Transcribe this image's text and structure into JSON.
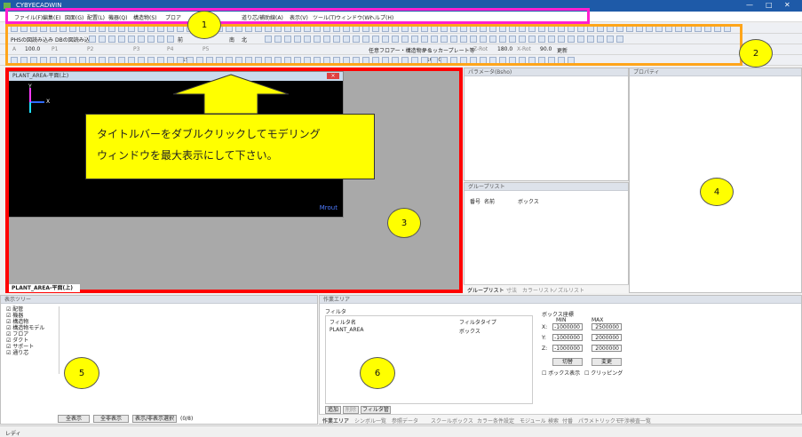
{
  "window": {
    "title": "CYBYECADWIN",
    "minimize": "—",
    "maximize": "□",
    "close": "✕"
  },
  "menu": [
    "ファイル(F)",
    "編集(E)",
    "図面(G)",
    "配置(L)",
    "機器(Q)",
    "構造物(S)",
    "プロア",
    "道り芯/補助線(A)",
    "表示(V)",
    "ツール(T)",
    "ウィンドウ(W)",
    "ヘルプ(H)"
  ],
  "toolbar": {
    "load_phs": "PHSの図読み込み",
    "load_db": "DBの図読み込み",
    "front": "前",
    "south": "南",
    "north": "北",
    "floor_label": "任意フロアー・構造物から",
    "checker_label": "チェッカープレート等",
    "zrot": "Z-Rot",
    "zrot_val": "180.0",
    "xrot": "X-Rot",
    "xrot_val": "90.0",
    "update": "更新",
    "row3_a": "100.0",
    "row3_b": "15.0",
    "row3_c": "100.0",
    "p1": "P1",
    "p2": "P2",
    "p3": "P3",
    "p4": "P4",
    "p5": "P5"
  },
  "model_window": {
    "title": "PLANT_AREA-平面(上)",
    "axis_x": "X",
    "axis_y": "Y",
    "corner_text": "Mrout",
    "tab_label": "PLANT_AREA-平面(上)",
    "close": "×"
  },
  "callout": {
    "line1": "タイトルバーをダブルクリックしてモデリング",
    "line2": "ウィンドウを最大表示にして下さい。"
  },
  "callout_nums": [
    "1",
    "2",
    "3",
    "4",
    "5",
    "6"
  ],
  "param_panel": {
    "title": "パラメータ(Bsho)"
  },
  "group_panel": {
    "title": "グループリスト",
    "cols": [
      "番号",
      "名前",
      "ボックス"
    ]
  },
  "group_tabs": [
    "グループリスト",
    "寸法",
    "カラーリスト",
    "ノズルリスト"
  ],
  "prop_panel": {
    "title": "プロパティ"
  },
  "tree_panel": {
    "title": "表示ツリー",
    "items": [
      "配管",
      "機器",
      "構造物",
      "構造物モデル",
      "フロア",
      "ダクト",
      "サポート",
      "通り芯"
    ],
    "btn_hide": "全表示",
    "btn_show": "全非表示",
    "btn_sel": "表示/非表示選択",
    "count": "(0/8)"
  },
  "filter_panel": {
    "title": "作業エリア",
    "filter_label": "フィルタ",
    "col_name": "フィルタ名",
    "col_type": "フィルタタイプ",
    "row_name": "PLANT_AREA",
    "row_type": "ボックス",
    "box_label": "ボックス座標",
    "min": "MIN",
    "max": "MAX",
    "x_min": "-1000000",
    "x_max": "2500000",
    "y_min": "-1000000",
    "y_max": "2000000",
    "z_min": "-1000000",
    "z_max": "2000000",
    "btn_cut": "切替",
    "btn_change": "変更",
    "chk_box": "ボックス表示",
    "chk_clip": "クリッピング",
    "btn_add": "追加",
    "btn_del": "削除",
    "btn_manage": "フィルタ管理"
  },
  "bottom_tabs": [
    "作業エリア",
    "シンボル一覧",
    "参照データ",
    "スクールボックス",
    "カラー条件設定",
    "モジュール",
    "検索",
    "付番",
    "パラメトリックモ",
    "干渉検査一覧"
  ],
  "status": "レディ"
}
